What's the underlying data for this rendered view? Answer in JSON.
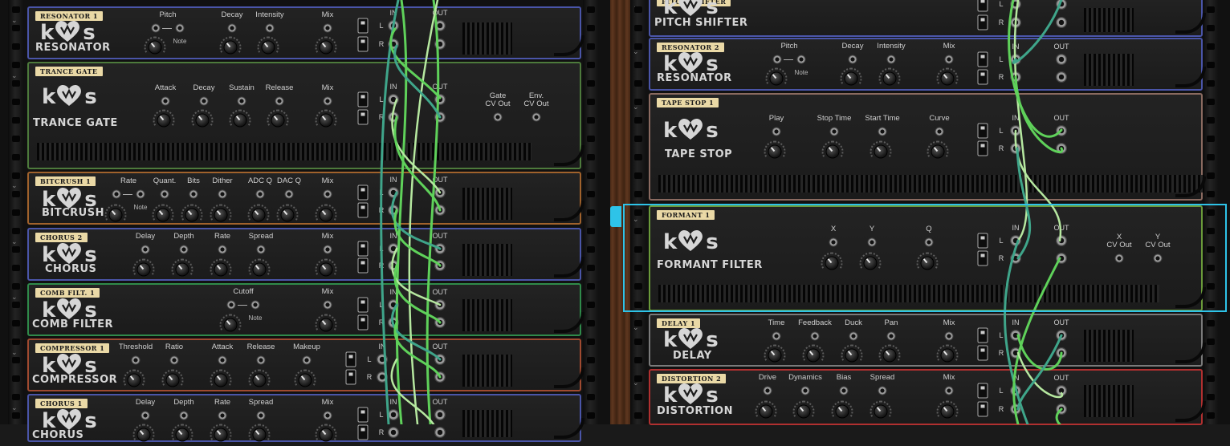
{
  "left_rack": {
    "units": [
      {
        "tag": "RESONATOR 1",
        "name": "RESONATOR",
        "color": "#4a55a8",
        "params": [
          {
            "label": "Pitch",
            "type": "toggle"
          },
          {
            "label": "Decay",
            "type": "knob"
          },
          {
            "label": "Intensity",
            "type": "knob"
          },
          {
            "label": "Mix",
            "type": "knob"
          }
        ],
        "note": "Note"
      },
      {
        "tag": "TRANCE GATE",
        "name": "TRANCE GATE",
        "color": "#4d7a3c",
        "params": [
          {
            "label": "Attack"
          },
          {
            "label": "Decay"
          },
          {
            "label": "Sustain"
          },
          {
            "label": "Release"
          },
          {
            "label": "Mix"
          }
        ],
        "cv_outputs": [
          "Gate\nCV Out",
          "Env.\nCV Out"
        ]
      },
      {
        "tag": "BITCRUSH 1",
        "name": "BITCRUSH",
        "color": "#a0622c",
        "params": [
          {
            "label": "Rate"
          },
          {
            "label": "Quant."
          },
          {
            "label": "Bits"
          },
          {
            "label": "Dither"
          },
          {
            "label": "ADC Q"
          },
          {
            "label": "DAC Q"
          },
          {
            "label": "Mix"
          }
        ],
        "note": "Note"
      },
      {
        "tag": "CHORUS 2",
        "name": "CHORUS",
        "color": "#4a55a8",
        "params": [
          {
            "label": "Delay"
          },
          {
            "label": "Depth"
          },
          {
            "label": "Rate"
          },
          {
            "label": "Spread"
          },
          {
            "label": "Mix"
          }
        ]
      },
      {
        "tag": "COMB FILT. 1",
        "name": "COMB FILTER",
        "color": "#2f8a4a",
        "params": [
          {
            "label": "Cutoff"
          },
          {
            "label": "Mix"
          }
        ],
        "note": "Note"
      },
      {
        "tag": "COMPRESSOR 1",
        "name": "COMPRESSOR",
        "color": "#a04a30",
        "params": [
          {
            "label": "Threshold"
          },
          {
            "label": "Ratio"
          },
          {
            "label": "Attack"
          },
          {
            "label": "Release"
          },
          {
            "label": "Makeup"
          }
        ]
      },
      {
        "tag": "CHORUS 1",
        "name": "CHORUS",
        "color": "#4a55a8",
        "params": [
          {
            "label": "Delay"
          },
          {
            "label": "Depth"
          },
          {
            "label": "Rate"
          },
          {
            "label": "Spread"
          },
          {
            "label": "Mix"
          }
        ]
      }
    ]
  },
  "right_rack": {
    "units": [
      {
        "tag": "PITCH SHIFTER",
        "name": "PITCH SHIFTER",
        "color": "#4a55a8"
      },
      {
        "tag": "RESONATOR 2",
        "name": "RESONATOR",
        "color": "#4a55a8",
        "params": [
          {
            "label": "Pitch"
          },
          {
            "label": "Decay"
          },
          {
            "label": "Intensity"
          },
          {
            "label": "Mix"
          }
        ],
        "note": "Note"
      },
      {
        "tag": "TAPE STOP 1",
        "name": "TAPE STOP",
        "color": "#8a6a60",
        "params": [
          {
            "label": "Play"
          },
          {
            "label": "Stop Time"
          },
          {
            "label": "Start Time"
          },
          {
            "label": "Curve"
          }
        ]
      },
      {
        "tag": "FORMANT 1",
        "name": "FORMANT FILTER",
        "color": "#6a9a3a",
        "selected": true,
        "params": [
          {
            "label": "X"
          },
          {
            "label": "Y"
          },
          {
            "label": "Q"
          }
        ],
        "cv_outputs": [
          "X\nCV Out",
          "Y\nCV Out"
        ]
      },
      {
        "tag": "DELAY 1",
        "name": "DELAY",
        "color": "#7a7a7a",
        "params": [
          {
            "label": "Time"
          },
          {
            "label": "Feedback"
          },
          {
            "label": "Duck"
          },
          {
            "label": "Pan"
          },
          {
            "label": "Mix"
          }
        ]
      },
      {
        "tag": "DISTORTION 2",
        "name": "DISTORTION",
        "color": "#b03030",
        "params": [
          {
            "label": "Drive"
          },
          {
            "label": "Dynamics"
          },
          {
            "label": "Bias"
          },
          {
            "label": "Spread"
          },
          {
            "label": "Mix"
          }
        ]
      }
    ]
  },
  "io": {
    "in": "IN",
    "out": "OUT",
    "left": "L",
    "right": "R"
  },
  "logo": {
    "k": "k",
    "s": "s"
  },
  "colors": {
    "selection": "#2ec3e8",
    "cable_green": "#5fd15a",
    "cable_teal": "#3fa58a",
    "cable_light": "#b6e8a0"
  }
}
